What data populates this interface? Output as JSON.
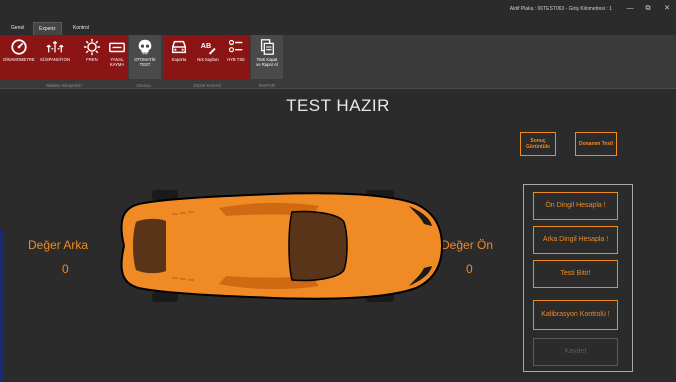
{
  "window": {
    "plate_info": "Aktif Plaka : 06TEST063 - Giriş Kilometresi : 1",
    "controls": {
      "minimize": "—",
      "maximize": "⧉",
      "close": "✕"
    }
  },
  "tabs": [
    {
      "label": "Genel"
    },
    {
      "label": "Experiz"
    },
    {
      "label": "Kontrol"
    }
  ],
  "ribbon": {
    "groups": [
      {
        "label": "Makine Ekspertizi",
        "buttons": [
          {
            "label": "DİNAMOMETRE",
            "icon": "speedometer-icon"
          },
          {
            "label": "SÜSPANSİYON",
            "icon": "suspension-icon"
          },
          {
            "label": "FREN",
            "icon": "brake-icon"
          },
          {
            "label": "YANAL",
            "label2": "KAYMA",
            "icon": "side-slip-icon"
          }
        ]
      },
      {
        "label": "Otoma...",
        "buttons": [
          {
            "label": "OTOMATİK",
            "label2": "TEST",
            "icon": "skull-icon"
          }
        ]
      },
      {
        "label": "Gözle Kontrol",
        "buttons": [
          {
            "label": "Kaporta",
            "icon": "car-front-icon"
          },
          {
            "label": "Not Sayfası",
            "icon": "notes-icon"
          },
          {
            "label": "HYB TSE",
            "icon": "checklist-icon"
          }
        ]
      },
      {
        "label": "RAPOR",
        "buttons": [
          {
            "label": "Testi Kapat",
            "label2": "ve Rapor Al",
            "icon": "report-icon"
          }
        ]
      }
    ]
  },
  "main": {
    "title": "TEST HAZIR",
    "buttons": {
      "sonuc": "Sonuç Görüntüle",
      "donanim": "Donanım Testi"
    },
    "rear_label": "Değer Arka",
    "rear_value": "0",
    "front_label": "Değer Ön",
    "front_value": "0",
    "panel": {
      "on_dingil": "Ön Dingil Hesapla !",
      "arka_dingil": "Arka Dingil Hesapla !",
      "testi_bitir": "Testi Bitir!",
      "kalibrasyon": "Kalibrasyon Kontrolü !",
      "kaydet": "Kaydet"
    }
  },
  "colors": {
    "accent": "#f08a25",
    "ribbon_red": "#8b1515",
    "background": "#2b2b2b"
  }
}
